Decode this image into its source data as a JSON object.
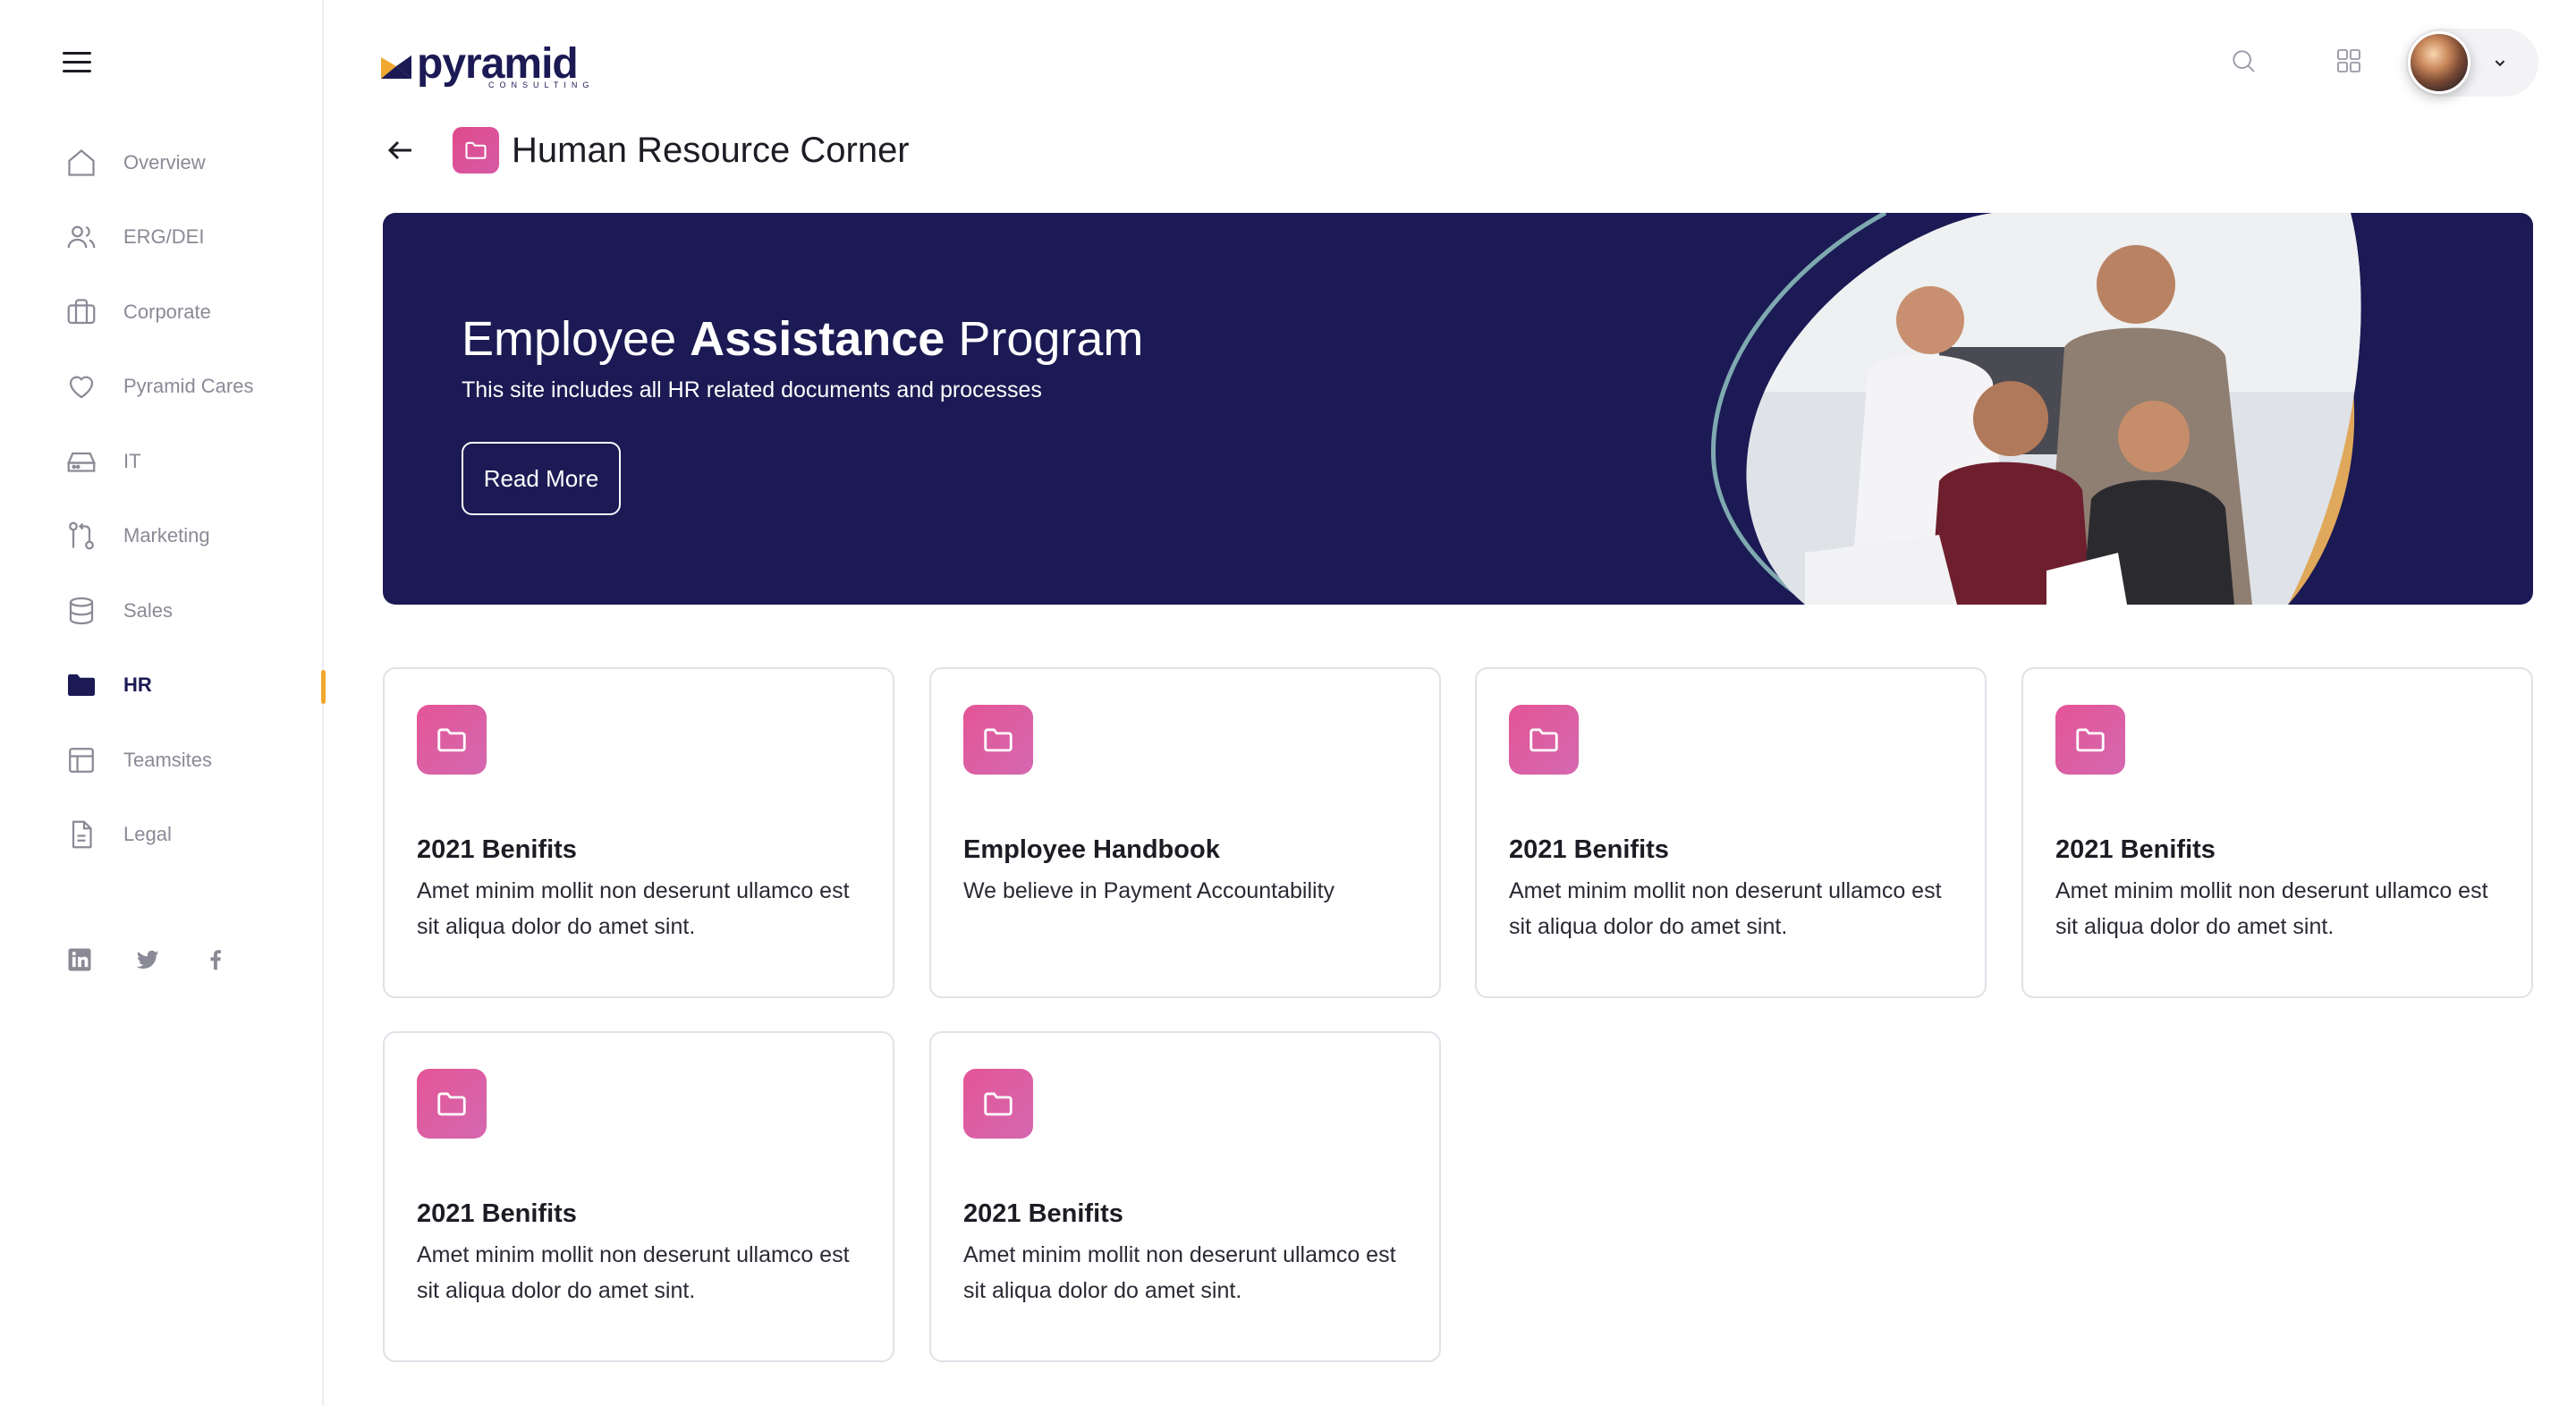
{
  "app": {
    "logo_word": "pyramid",
    "logo_sub": "CONSULTING"
  },
  "sidebar": {
    "items": [
      {
        "label": "Overview",
        "icon": "home-icon"
      },
      {
        "label": "ERG/DEI",
        "icon": "users-icon"
      },
      {
        "label": "Corporate",
        "icon": "briefcase-icon"
      },
      {
        "label": "Pyramid Cares",
        "icon": "heart-icon"
      },
      {
        "label": "IT",
        "icon": "hard-drive-icon"
      },
      {
        "label": "Marketing",
        "icon": "git-pull-icon"
      },
      {
        "label": "Sales",
        "icon": "database-icon"
      },
      {
        "label": "HR",
        "icon": "folder-icon",
        "active": true
      },
      {
        "label": "Teamsites",
        "icon": "layout-icon"
      },
      {
        "label": "Legal",
        "icon": "file-icon"
      }
    ],
    "social": [
      "linkedin-icon",
      "twitter-icon",
      "facebook-icon"
    ]
  },
  "header": {
    "icons": [
      "search-icon",
      "apps-grid-icon",
      "chevron-down-icon"
    ]
  },
  "page": {
    "title": "Human Resource Corner"
  },
  "banner": {
    "title_pre": "Employee ",
    "title_bold": "Assistance",
    "title_post": " Program",
    "subtitle": "This site includes all HR related documents and processes",
    "button": "Read More"
  },
  "cards": [
    {
      "title": "2021 Benifits",
      "desc": "Amet minim mollit non deserunt ullamco est sit aliqua dolor do amet sint."
    },
    {
      "title": "Employee Handbook",
      "desc": "We believe in Payment Accountability"
    },
    {
      "title": "2021 Benifits",
      "desc": "Amet minim mollit non deserunt ullamco est sit aliqua dolor do amet sint."
    },
    {
      "title": "2021 Benifits",
      "desc": "Amet minim mollit non deserunt ullamco est sit aliqua dolor do amet sint."
    },
    {
      "title": "2021 Benifits",
      "desc": "Amet minim mollit non deserunt ullamco est sit aliqua dolor do amet sint."
    },
    {
      "title": "2021 Benifits",
      "desc": "Amet minim mollit non deserunt ullamco est sit aliqua dolor do amet sint."
    }
  ],
  "colors": {
    "brand_navy": "#1b1a54",
    "accent_pink": "#e04a8a",
    "active_bar": "#f0a830",
    "muted_text": "#8a8a96"
  }
}
